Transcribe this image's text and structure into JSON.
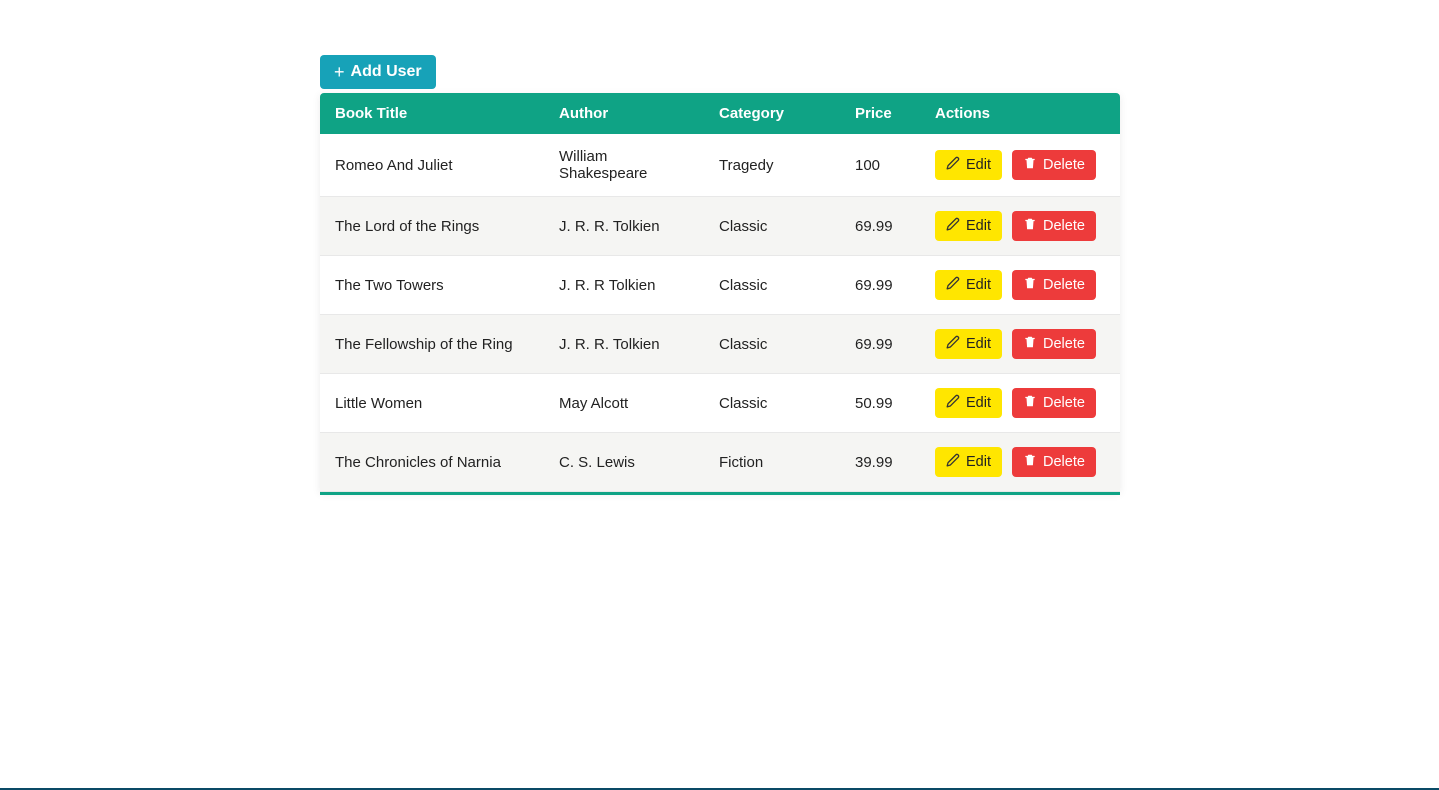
{
  "colors": {
    "primary": "#0fa385",
    "info": "#17a2b8",
    "warning": "#ffe600",
    "danger": "#ed3b3b"
  },
  "toolbar": {
    "add_user_label": "Add User"
  },
  "buttons": {
    "edit_label": "Edit",
    "delete_label": "Delete"
  },
  "table": {
    "headers": {
      "title": "Book Title",
      "author": "Author",
      "category": "Category",
      "price": "Price",
      "actions": "Actions"
    },
    "rows": [
      {
        "title": "Romeo And Juliet",
        "author": "William Shakespeare",
        "category": "Tragedy",
        "price": "100"
      },
      {
        "title": "The Lord of the Rings",
        "author": "J. R. R. Tolkien",
        "category": "Classic",
        "price": "69.99"
      },
      {
        "title": "The Two Towers",
        "author": "J. R. R Tolkien",
        "category": "Classic",
        "price": "69.99"
      },
      {
        "title": "The Fellowship of the Ring",
        "author": "J. R. R. Tolkien",
        "category": "Classic",
        "price": "69.99"
      },
      {
        "title": "Little Women",
        "author": "May Alcott",
        "category": "Classic",
        "price": "50.99"
      },
      {
        "title": "The Chronicles of Narnia",
        "author": "C. S. Lewis",
        "category": "Fiction",
        "price": "39.99"
      }
    ]
  }
}
